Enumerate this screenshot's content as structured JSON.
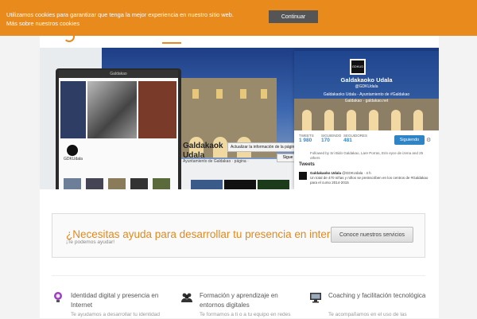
{
  "cookie": {
    "message_line1": "Utilizamos cookies para garantizar que tenga la mejor experiencia en nuestro sitio web.",
    "message_line2": "Más sobre nuestros cookies",
    "accept_label": "Continuar",
    "bg_color": "#e98a1c"
  },
  "hero": {
    "tablet_app_title": "Galdakao",
    "tablet_handle": "GDKUdala",
    "facebook": {
      "page_name_line1": "Galdakaok",
      "page_name_line2": "Udala",
      "desc": "Ayuntamiento de Galdakao · página ·",
      "update_button": "Actualizar la información de la página",
      "follow_small": "Sigue"
    },
    "twitter": {
      "avatar_text": "GDKUD",
      "name": "Galdakaoko Udala",
      "handle": "@GDKUdala",
      "bio": "Galdakaoko Udala - Ayuntamiento de #Galdakao",
      "url": "Galdakao · galdakao.net",
      "stats": [
        {
          "label": "TWEETS",
          "value": "1 980"
        },
        {
          "label": "SIGUIENDO",
          "value": "170"
        },
        {
          "label": "SEGUIDORES",
          "value": "481"
        }
      ],
      "follow_button": "Siguiendo",
      "followed_by": "Followed by Sri Bido Galdakao, Lare Porras, Erin eyce de izena and 25 others",
      "tweets_title": "Tweets",
      "tweet_author": "Galdakaoko Udala",
      "tweet_handle": "@GDKUdala · 4 h",
      "tweet_text": "Un total de 470 niñas y niños se preinscriben en los centros de #Galdakao para el curso 2014-2015"
    }
  },
  "cta": {
    "title": "¿Necesitas ayuda para desarrollar tu presencia en internet?",
    "subtitle": "¡Te podemos ayudar!",
    "button_label": "Conoce nuestros servicios",
    "accent_color": "#e08a1e"
  },
  "services": [
    {
      "icon": "lightbulb-icon",
      "title": "Identidad digital y presencia en Internet",
      "desc": "Te ayudamos a desarrollar tu identidad"
    },
    {
      "icon": "people-icon",
      "title": "Formación y aprendizaje en entornos digitales",
      "desc": "Te formamos a ti o a tu equipo en redes"
    },
    {
      "icon": "monitor-icon",
      "title": "Coaching y facilitación tecnológica",
      "desc": "Te acompañamos en el uso de las"
    }
  ]
}
